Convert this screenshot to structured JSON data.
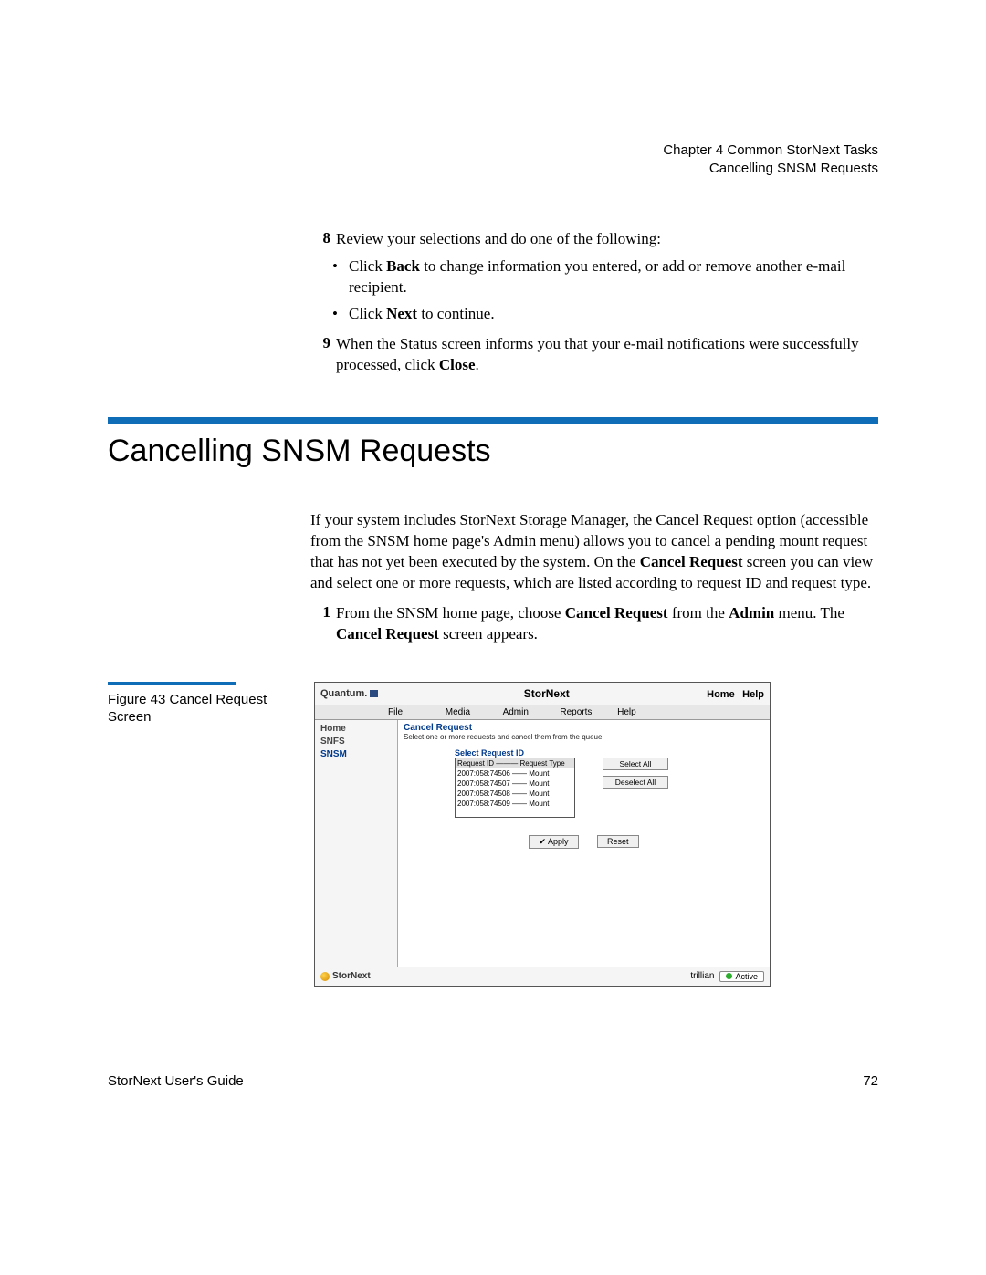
{
  "header": {
    "chapter": "Chapter 4  Common StorNext Tasks",
    "section": "Cancelling SNSM Requests"
  },
  "steps_top": {
    "s8_num": "8",
    "s8_text": "Review your selections and do one of the following:",
    "s8_b1_pre": "Click ",
    "s8_b1_bold": "Back",
    "s8_b1_post": " to change information you entered, or add or remove another e-mail recipient.",
    "s8_b2_pre": "Click ",
    "s8_b2_bold": "Next",
    "s8_b2_post": " to continue.",
    "s9_num": "9",
    "s9_pre": "When the Status screen informs you that your e-mail notifications were successfully processed, click ",
    "s9_bold": "Close",
    "s9_post": "."
  },
  "section_title": "Cancelling SNSM Requests",
  "intro": {
    "p1_a": "If your system includes StorNext Storage Manager, the Cancel Request option (accessible from the SNSM home page's Admin menu) allows you to cancel a pending mount request that has not yet been executed by the system. On the ",
    "p1_bold1": "Cancel Request",
    "p1_b": " screen you can view and select one or more requests, which are listed according to request ID and request type.",
    "s1_num": "1",
    "s1_a": "From the SNSM home page, choose ",
    "s1_b1": "Cancel Request",
    "s1_b": " from the ",
    "s1_b2": "Admin",
    "s1_c": " menu. The ",
    "s1_b3": "Cancel Request",
    "s1_d": " screen appears."
  },
  "figure": {
    "label_a": "Figure 43  Cancel Request",
    "label_b": "Screen"
  },
  "screenshot": {
    "brand": "Quantum.",
    "product": "StorNext",
    "link_home": "Home",
    "link_help": "Help",
    "menu": {
      "file": "File",
      "media": "Media",
      "admin": "Admin",
      "reports": "Reports",
      "help": "Help"
    },
    "side": {
      "home": "Home",
      "snfs": "SNFS",
      "snsm": "SNSM"
    },
    "panel_title": "Cancel Request",
    "panel_sub": "Select one or more requests and cancel them from the queue.",
    "list_header": "Select Request ID",
    "list_colrow": "Request ID ——— Request Type",
    "rows": [
      "2007:058:74506 —— Mount",
      "2007:058:74507 —— Mount",
      "2007:058:74508 —— Mount",
      "2007:058:74509 —— Mount"
    ],
    "btn_select_all": "Select All",
    "btn_deselect_all": "Deselect All",
    "btn_apply": "✔ Apply",
    "btn_reset": "Reset",
    "footer_brand": "StorNext",
    "footer_host": "trillian",
    "footer_status": "Active"
  },
  "footer": {
    "left": "StorNext User's Guide",
    "right": "72"
  }
}
